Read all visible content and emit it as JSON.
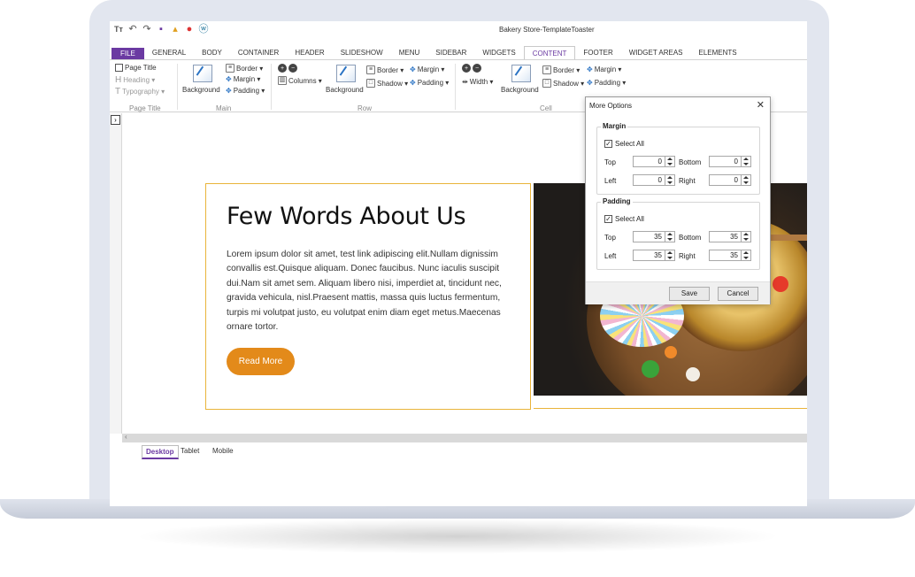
{
  "app": {
    "window_title": "Bakery Store-TemplateToaster",
    "quick_access_icons": [
      "text-icon",
      "undo-icon",
      "redo-icon",
      "save-icon",
      "export-icon",
      "browser-icon",
      "wordpress-icon"
    ]
  },
  "tabs": {
    "file": "FILE",
    "items": [
      "GENERAL",
      "BODY",
      "CONTAINER",
      "HEADER",
      "SLIDESHOW",
      "MENU",
      "SIDEBAR",
      "WIDGETS",
      "CONTENT",
      "FOOTER",
      "WIDGET AREAS",
      "ELEMENTS"
    ],
    "active": "CONTENT"
  },
  "ribbon": {
    "page_title_group": {
      "page_title": "Page Title",
      "heading": "Heading ▾",
      "typography": "Typography ▾",
      "group_label": "Page Title"
    },
    "main_group": {
      "background": "Background",
      "border": "Border ▾",
      "margin": "Margin ▾",
      "padding": "Padding ▾",
      "group_label": "Main"
    },
    "row_group": {
      "columns": "Columns ▾",
      "background": "Background",
      "border": "Border ▾",
      "shadow": "Shadow ▾",
      "margin": "Margin ▾",
      "padding": "Padding ▾",
      "group_label": "Row"
    },
    "cell_group": {
      "width": "Width ▾",
      "background": "Background",
      "border": "Border ▾",
      "shadow": "Shadow ▾",
      "margin": "Margin ▾",
      "padding": "Padding ▾",
      "group_label": "Cell"
    }
  },
  "page": {
    "heading": "Few Words About Us",
    "paragraph": "Lorem ipsum dolor sit amet, test link adipiscing elit.Nullam dignissim convallis est.Quisque aliquam. Donec faucibus. Nunc iaculis suscipit dui.Nam sit amet sem. Aliquam libero nisi, imperdiet at, tincidunt nec, gravida vehicula, nisl.Praesent mattis, massa quis luctus fermentum, turpis mi volutpat justo, eu volutpat enim diam eget metus.Maecenas ornare tortor.",
    "read_more": "Read More",
    "accent_color": "#e38a1a",
    "border_color": "#e9b43a"
  },
  "view_tabs": {
    "items": [
      "Desktop",
      "Tablet",
      "Mobile"
    ],
    "active": "Desktop"
  },
  "dialog": {
    "title": "More Options",
    "close": "✕",
    "margin": {
      "legend": "Margin",
      "select_all": "Select All",
      "top_label": "Top",
      "top": "0",
      "bottom_label": "Bottom",
      "bottom": "0",
      "left_label": "Left",
      "left": "0",
      "right_label": "Right",
      "right": "0"
    },
    "padding": {
      "legend": "Padding",
      "select_all": "Select All",
      "top_label": "Top",
      "top": "35",
      "bottom_label": "Bottom",
      "bottom": "35",
      "left_label": "Left",
      "left": "35",
      "right_label": "Right",
      "right": "35"
    },
    "save": "Save",
    "cancel": "Cancel"
  }
}
